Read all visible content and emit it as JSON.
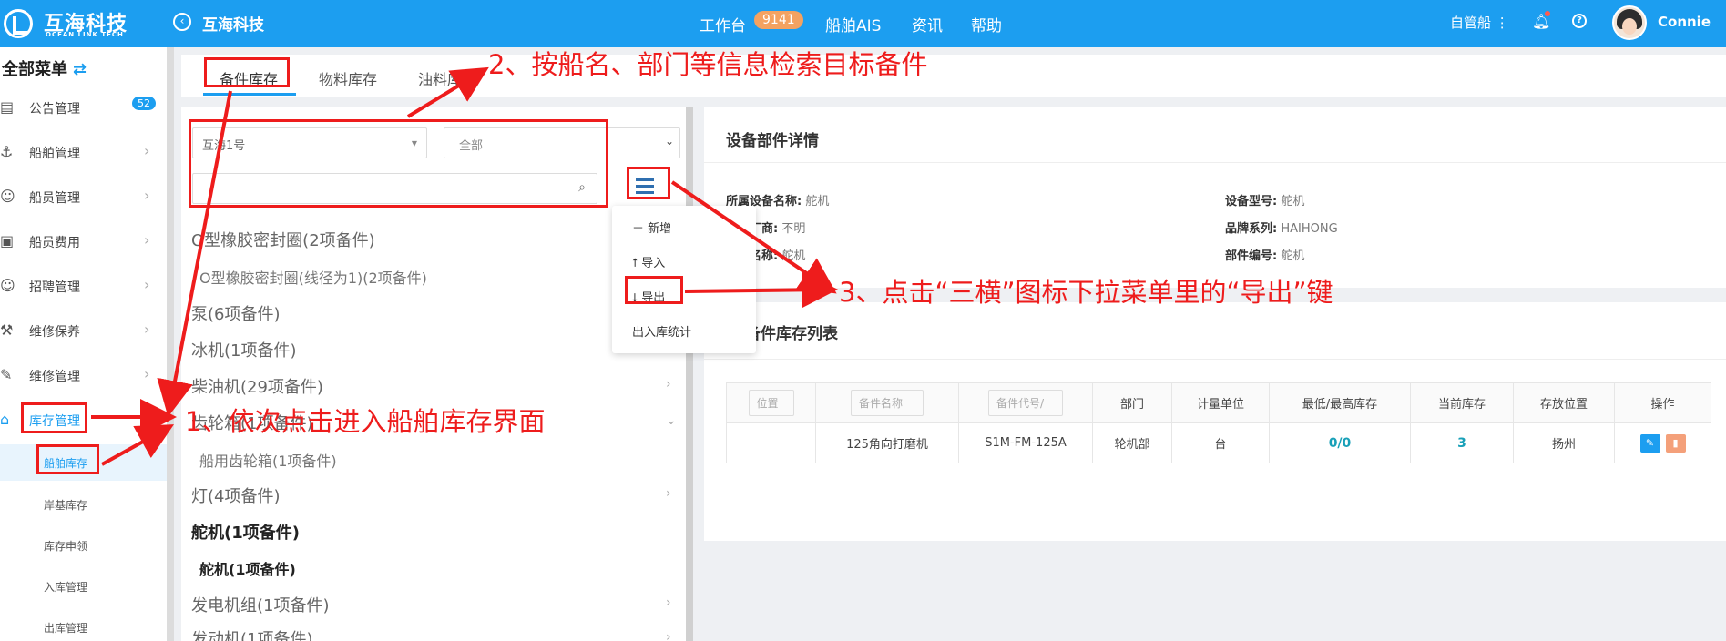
{
  "header": {
    "logo_cn": "互海科技",
    "logo_en": "OCEAN LINK TECH",
    "app_title": "互海科技",
    "nav": [
      "工作台",
      "船舶AIS",
      "资讯",
      "帮助"
    ],
    "workbench_badge": "9141",
    "ship_select": "自管船 ⋮",
    "username": "Connie"
  },
  "sidebar": {
    "heading": "全部菜单",
    "items": [
      {
        "label": "公告管理",
        "badge": "52"
      },
      {
        "label": "船舶管理"
      },
      {
        "label": "船员管理"
      },
      {
        "label": "船员费用"
      },
      {
        "label": "招聘管理"
      },
      {
        "label": "维修保养"
      },
      {
        "label": "维修管理"
      },
      {
        "label": "库存管理"
      }
    ],
    "sub_items": [
      "船舶库存",
      "岸基库存",
      "库存申领",
      "入库管理",
      "出库管理"
    ]
  },
  "tabs": [
    "备件库存",
    "物料库存",
    "油料库存"
  ],
  "filters": {
    "ship": "互海1号",
    "department": "全部"
  },
  "tree": [
    "O型橡胶密封圈(2项备件)",
    "O型橡胶密封圈(线径为1)(2项备件)",
    "泵(6项备件)",
    "冰机(1项备件)",
    "柴油机(29项备件)",
    "齿轮箱(1项备件)",
    "船用齿轮箱(1项备件)",
    "灯(4项备件)",
    "舵机(1项备件)",
    "舵机(1项备件)",
    "发电机组(1项备件)",
    "发动机(1项备件)"
  ],
  "dropdown": [
    "新增",
    "导入",
    "导出",
    "出入库统计"
  ],
  "detail_panel": {
    "title": "设备部件详情",
    "fields": [
      {
        "label": "所属设备名称:",
        "value": "舵机"
      },
      {
        "label": "生产厂商:",
        "value": "不明"
      },
      {
        "label": "部件名称:",
        "value": "舵机"
      },
      {
        "label": "设备型号:",
        "value": "舵机"
      },
      {
        "label": "品牌系列:",
        "value": "HAIHONG"
      },
      {
        "label": "部件编号:",
        "value": "舵机"
      }
    ]
  },
  "stock_panel": {
    "title": "备件库存列表",
    "columns": [
      "位置",
      "备件名称",
      "备件代号/",
      "部门",
      "计量单位",
      "最低/最高库存",
      "当前库存",
      "存放位置",
      "操作"
    ],
    "rows": [
      {
        "position": "",
        "name": "125角向打磨机",
        "code": "S1M-FM-125A",
        "dept": "轮机部",
        "unit": "台",
        "minmax": "0/0",
        "current": "3",
        "location": "扬州"
      }
    ]
  },
  "annotations": {
    "step1": "1、依次点击进入船舶库存界面",
    "step2": "2、按船名、部门等信息检索目标备件",
    "step3": "3、点击“三横”图标下拉菜单里的“导出”键"
  },
  "colors": {
    "primary": "#1c9ef0",
    "annotation_red": "#ee1c1c",
    "badge_orange": "#f4a261"
  }
}
